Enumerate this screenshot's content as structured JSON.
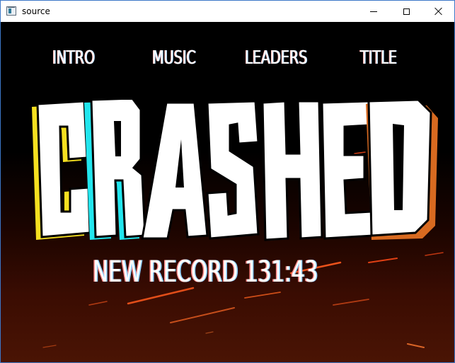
{
  "window": {
    "title": "source",
    "icon": "app-window-icon"
  },
  "menu": {
    "items": [
      {
        "label": "INTRO"
      },
      {
        "label": "MUSIC"
      },
      {
        "label": "LEADERS"
      },
      {
        "label": "TITLE"
      }
    ]
  },
  "logo": {
    "text": "CRASHED",
    "colors": {
      "face": "#ffffff",
      "outline": "#000000",
      "shadow_yellow": "#f5e020",
      "shadow_cyan": "#22e6ee",
      "shadow_orange": "#d86a20"
    }
  },
  "record": {
    "text": "NEW RECORD 131:43"
  },
  "theme": {
    "background_top": "#000000",
    "background_bottom": "#4a1404",
    "spark_color": "#ff5a1e"
  }
}
